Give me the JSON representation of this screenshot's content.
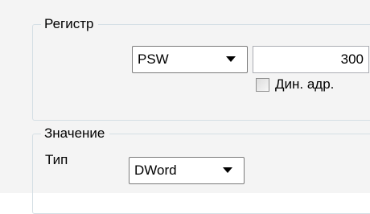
{
  "register_group": {
    "title": "Регистр",
    "register_combo": {
      "value": "PSW"
    },
    "address_field": {
      "value": "300"
    },
    "dynamic_address_checkbox": {
      "label": "Дин. адр.",
      "checked": false
    }
  },
  "value_group": {
    "title": "Значение",
    "type_label": "Тип",
    "type_combo": {
      "value": "DWord"
    }
  },
  "icons": {
    "register_combo_arrow": "chevron-down-icon",
    "type_combo_arrow": "chevron-down-icon"
  }
}
